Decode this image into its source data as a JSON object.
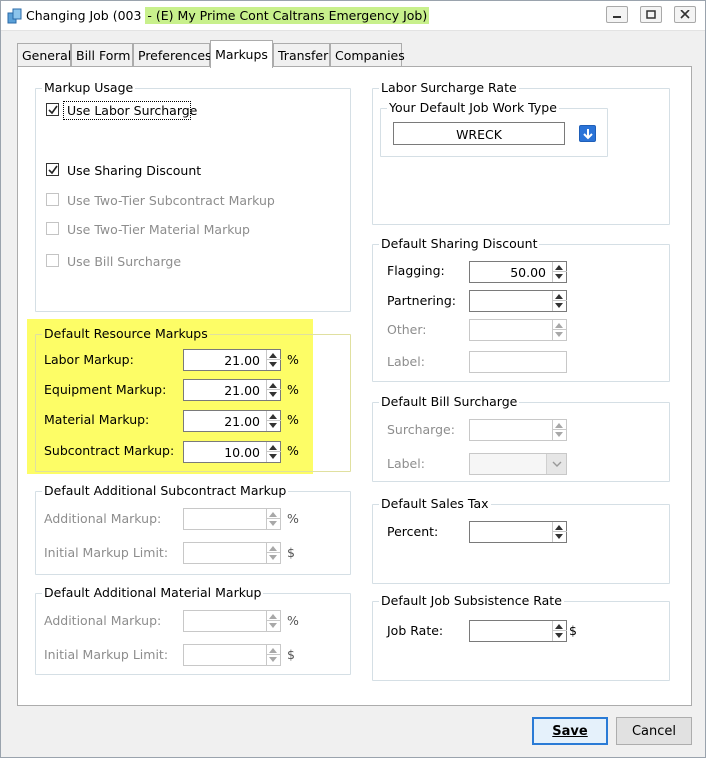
{
  "window": {
    "title_prefix": "Changing Job  (003 ",
    "title_highlight": "(E) My Prime Cont Caltrans Emergency Job)",
    "highlight_color": "#c8f08c"
  },
  "tabs": [
    "General",
    "Bill Form",
    "Preferences",
    "Markups",
    "Transfer",
    "Companies"
  ],
  "active_tab": "Markups",
  "markup_usage": {
    "title": "Markup Usage",
    "items": [
      {
        "label": "Use Labor Surcharge",
        "checked": true,
        "enabled": true
      },
      {
        "label": "Use Sharing Discount",
        "checked": true,
        "enabled": true
      },
      {
        "label": "Use Two-Tier Subcontract Markup",
        "checked": false,
        "enabled": false
      },
      {
        "label": "Use Two-Tier Material Markup",
        "checked": false,
        "enabled": false
      },
      {
        "label": "Use Bill Surcharge",
        "checked": false,
        "enabled": false
      }
    ]
  },
  "resource_markups": {
    "title": "Default Resource Markups",
    "highlight_color": "#fdfd66",
    "rows": [
      {
        "label": "Labor Markup:",
        "value": "21.00",
        "unit": "%"
      },
      {
        "label": "Equipment Markup:",
        "value": "21.00",
        "unit": "%"
      },
      {
        "label": "Material Markup:",
        "value": "21.00",
        "unit": "%"
      },
      {
        "label": "Subcontract Markup:",
        "value": "10.00",
        "unit": "%"
      }
    ]
  },
  "additional_subcontract": {
    "title": "Default Additional Subcontract Markup",
    "additional_label": "Additional Markup:",
    "additional_unit": "%",
    "limit_label": "Initial Markup Limit:",
    "limit_unit": "$"
  },
  "additional_material": {
    "title": "Default Additional Material Markup",
    "additional_label": "Additional Markup:",
    "additional_unit": "%",
    "limit_label": "Initial Markup Limit:",
    "limit_unit": "$"
  },
  "labor_surcharge": {
    "title": "Labor Surcharge Rate",
    "subgroup_title": "Your Default Job Work Type",
    "work_type": "WRECK",
    "lookup_icon": "down-arrow-icon"
  },
  "sharing_discount": {
    "title": "Default Sharing Discount",
    "flagging_label": "Flagging:",
    "flagging_value": "50.00",
    "partnering_label": "Partnering:",
    "other_label": "Other:",
    "label_label": "Label:"
  },
  "bill_surcharge": {
    "title": "Default Bill Surcharge",
    "surcharge_label": "Surcharge:",
    "label_label": "Label:"
  },
  "sales_tax": {
    "title": "Default Sales Tax",
    "percent_label": "Percent:"
  },
  "subsistence": {
    "title": "Default Job Subsistence Rate",
    "rate_label": "Job Rate:",
    "rate_unit": "$"
  },
  "buttons": {
    "save": "Save",
    "cancel": "Cancel"
  }
}
